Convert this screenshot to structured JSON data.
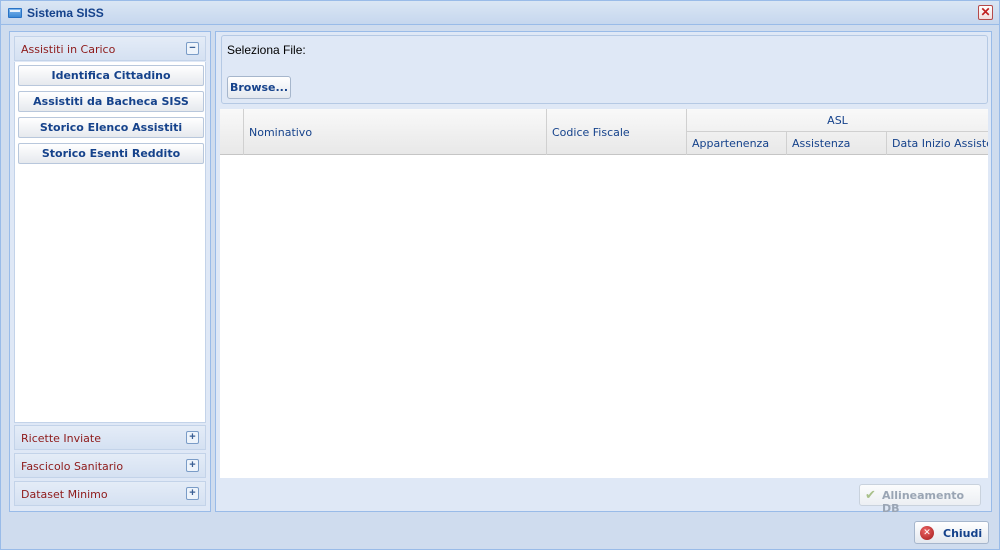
{
  "window": {
    "title": "Sistema SISS"
  },
  "sidebar": {
    "sections": [
      {
        "label": "Assistiti in Carico",
        "tool": "−"
      },
      {
        "label": "Ricette Inviate",
        "tool": "+"
      },
      {
        "label": "Fascicolo Sanitario",
        "tool": "+"
      },
      {
        "label": "Dataset Minimo",
        "tool": "+"
      }
    ],
    "buttons": [
      "Identifica Cittadino",
      "Assistiti da Bacheca SISS",
      "Storico Elenco Assistiti",
      "Storico Esenti Reddito"
    ]
  },
  "file": {
    "label": "Seleziona File:",
    "browse": "Browse..."
  },
  "grid": {
    "columns": {
      "nominativo": "Nominativo",
      "codice_fiscale": "Codice Fiscale",
      "asl_group": "ASL",
      "appartenenza": "Appartenenza",
      "assistenza": "Assistenza",
      "data_inizio": "Data Inizio Assisten"
    },
    "rows": []
  },
  "actions": {
    "allineamento": "Allineamento DB",
    "chiudi": "Chiudi"
  }
}
